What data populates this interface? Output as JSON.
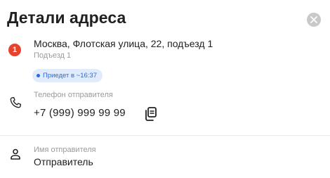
{
  "header": {
    "title": "Детали адреса",
    "close_icon": "close-icon"
  },
  "address": {
    "point_number": "1",
    "main": "Москва, Флотская улица, 22, подъезд 1",
    "sub": "Подъезд 1",
    "eta": "Приедет в ~16:37"
  },
  "phone": {
    "label": "Телефон отправителя",
    "value": "+7 (999) 999 99 99",
    "icon": "phone-icon",
    "copy_icon": "copy-icon"
  },
  "sender": {
    "label": "Имя отправителя",
    "value": "Отправитель",
    "icon": "person-icon"
  },
  "colors": {
    "point_badge": "#e8412c",
    "eta_bg": "#e0ebfc",
    "eta_text": "#2d69d9",
    "secondary_text": "#9e9b98",
    "close_bg": "#c9c9c9"
  }
}
